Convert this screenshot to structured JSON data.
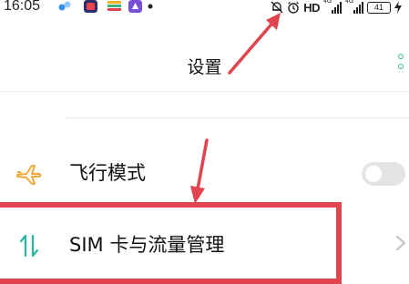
{
  "status_bar": {
    "time": "16:05",
    "hd_label": "HD",
    "network_1": "4G",
    "network_2": "4G",
    "battery_level": "41",
    "icons": [
      "app-notification-icon",
      "app-icon-red",
      "app-icon-rainbow",
      "app-icon-purple",
      "notification-dot-icon",
      "mute-bell-icon",
      "alarm-clock-icon",
      "signal-icon",
      "charging-icon"
    ]
  },
  "header": {
    "title": "设置",
    "more_icon": "more-vertical-icon"
  },
  "settings": {
    "items": [
      {
        "label": "飞行模式",
        "icon": "airplane-icon",
        "toggle_on": false
      },
      {
        "label": "SIM 卡与流量管理",
        "icon": "data-transfer-icon",
        "chevron": "chevron-right-icon"
      }
    ]
  },
  "colors": {
    "accent_teal": "#2bb6a1",
    "airplane_orange": "#f2a93b",
    "annotation_red": "#e2454f"
  }
}
